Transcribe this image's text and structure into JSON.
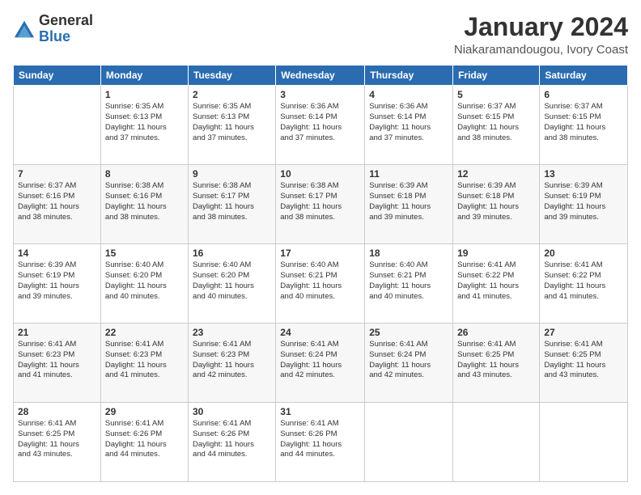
{
  "logo": {
    "general": "General",
    "blue": "Blue"
  },
  "title": "January 2024",
  "subtitle": "Niakaramandougou, Ivory Coast",
  "weekdays": [
    "Sunday",
    "Monday",
    "Tuesday",
    "Wednesday",
    "Thursday",
    "Friday",
    "Saturday"
  ],
  "weeks": [
    [
      {
        "day": "",
        "info": ""
      },
      {
        "day": "1",
        "info": "Sunrise: 6:35 AM\nSunset: 6:13 PM\nDaylight: 11 hours\nand 37 minutes."
      },
      {
        "day": "2",
        "info": "Sunrise: 6:35 AM\nSunset: 6:13 PM\nDaylight: 11 hours\nand 37 minutes."
      },
      {
        "day": "3",
        "info": "Sunrise: 6:36 AM\nSunset: 6:14 PM\nDaylight: 11 hours\nand 37 minutes."
      },
      {
        "day": "4",
        "info": "Sunrise: 6:36 AM\nSunset: 6:14 PM\nDaylight: 11 hours\nand 37 minutes."
      },
      {
        "day": "5",
        "info": "Sunrise: 6:37 AM\nSunset: 6:15 PM\nDaylight: 11 hours\nand 38 minutes."
      },
      {
        "day": "6",
        "info": "Sunrise: 6:37 AM\nSunset: 6:15 PM\nDaylight: 11 hours\nand 38 minutes."
      }
    ],
    [
      {
        "day": "7",
        "info": "Sunrise: 6:37 AM\nSunset: 6:16 PM\nDaylight: 11 hours\nand 38 minutes."
      },
      {
        "day": "8",
        "info": "Sunrise: 6:38 AM\nSunset: 6:16 PM\nDaylight: 11 hours\nand 38 minutes."
      },
      {
        "day": "9",
        "info": "Sunrise: 6:38 AM\nSunset: 6:17 PM\nDaylight: 11 hours\nand 38 minutes."
      },
      {
        "day": "10",
        "info": "Sunrise: 6:38 AM\nSunset: 6:17 PM\nDaylight: 11 hours\nand 38 minutes."
      },
      {
        "day": "11",
        "info": "Sunrise: 6:39 AM\nSunset: 6:18 PM\nDaylight: 11 hours\nand 39 minutes."
      },
      {
        "day": "12",
        "info": "Sunrise: 6:39 AM\nSunset: 6:18 PM\nDaylight: 11 hours\nand 39 minutes."
      },
      {
        "day": "13",
        "info": "Sunrise: 6:39 AM\nSunset: 6:19 PM\nDaylight: 11 hours\nand 39 minutes."
      }
    ],
    [
      {
        "day": "14",
        "info": "Sunrise: 6:39 AM\nSunset: 6:19 PM\nDaylight: 11 hours\nand 39 minutes."
      },
      {
        "day": "15",
        "info": "Sunrise: 6:40 AM\nSunset: 6:20 PM\nDaylight: 11 hours\nand 40 minutes."
      },
      {
        "day": "16",
        "info": "Sunrise: 6:40 AM\nSunset: 6:20 PM\nDaylight: 11 hours\nand 40 minutes."
      },
      {
        "day": "17",
        "info": "Sunrise: 6:40 AM\nSunset: 6:21 PM\nDaylight: 11 hours\nand 40 minutes."
      },
      {
        "day": "18",
        "info": "Sunrise: 6:40 AM\nSunset: 6:21 PM\nDaylight: 11 hours\nand 40 minutes."
      },
      {
        "day": "19",
        "info": "Sunrise: 6:41 AM\nSunset: 6:22 PM\nDaylight: 11 hours\nand 41 minutes."
      },
      {
        "day": "20",
        "info": "Sunrise: 6:41 AM\nSunset: 6:22 PM\nDaylight: 11 hours\nand 41 minutes."
      }
    ],
    [
      {
        "day": "21",
        "info": "Sunrise: 6:41 AM\nSunset: 6:23 PM\nDaylight: 11 hours\nand 41 minutes."
      },
      {
        "day": "22",
        "info": "Sunrise: 6:41 AM\nSunset: 6:23 PM\nDaylight: 11 hours\nand 41 minutes."
      },
      {
        "day": "23",
        "info": "Sunrise: 6:41 AM\nSunset: 6:23 PM\nDaylight: 11 hours\nand 42 minutes."
      },
      {
        "day": "24",
        "info": "Sunrise: 6:41 AM\nSunset: 6:24 PM\nDaylight: 11 hours\nand 42 minutes."
      },
      {
        "day": "25",
        "info": "Sunrise: 6:41 AM\nSunset: 6:24 PM\nDaylight: 11 hours\nand 42 minutes."
      },
      {
        "day": "26",
        "info": "Sunrise: 6:41 AM\nSunset: 6:25 PM\nDaylight: 11 hours\nand 43 minutes."
      },
      {
        "day": "27",
        "info": "Sunrise: 6:41 AM\nSunset: 6:25 PM\nDaylight: 11 hours\nand 43 minutes."
      }
    ],
    [
      {
        "day": "28",
        "info": "Sunrise: 6:41 AM\nSunset: 6:25 PM\nDaylight: 11 hours\nand 43 minutes."
      },
      {
        "day": "29",
        "info": "Sunrise: 6:41 AM\nSunset: 6:26 PM\nDaylight: 11 hours\nand 44 minutes."
      },
      {
        "day": "30",
        "info": "Sunrise: 6:41 AM\nSunset: 6:26 PM\nDaylight: 11 hours\nand 44 minutes."
      },
      {
        "day": "31",
        "info": "Sunrise: 6:41 AM\nSunset: 6:26 PM\nDaylight: 11 hours\nand 44 minutes."
      },
      {
        "day": "",
        "info": ""
      },
      {
        "day": "",
        "info": ""
      },
      {
        "day": "",
        "info": ""
      }
    ]
  ]
}
